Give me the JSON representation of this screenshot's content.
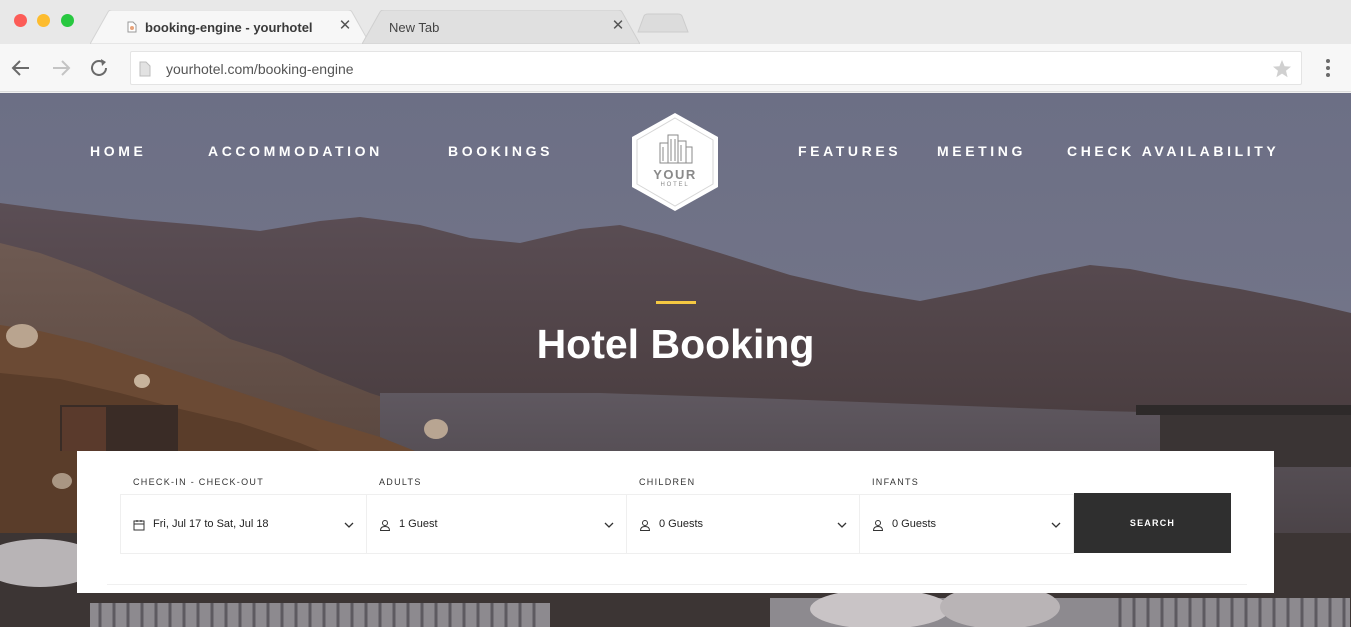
{
  "browser": {
    "tabs": [
      {
        "title": "booking-engine - yourhotel",
        "active": true
      },
      {
        "title": "New Tab",
        "active": false
      }
    ],
    "close_glyph": "✕",
    "url": "yourhotel.com/booking-engine",
    "icons": [
      "arrow-left-icon",
      "arrow-right-icon",
      "reload-icon",
      "page-icon",
      "star-icon",
      "kebab-menu-icon",
      "close-icon"
    ]
  },
  "nav": {
    "left": [
      "HOME",
      "ACCOMMODATION",
      "BOOKINGS"
    ],
    "right": [
      "FEATURES",
      "MEETING",
      "CHECK AVAILABILITY"
    ]
  },
  "logo": {
    "line1": "YOUR",
    "line2": "HOTEL"
  },
  "hero": {
    "title": "Hotel Booking",
    "accent_color": "#f5c842"
  },
  "booking": {
    "dates": {
      "label": "CHECK-IN - CHECK-OUT",
      "value": "Fri, Jul 17 to Sat, Jul 18"
    },
    "adults": {
      "label": "ADULTS",
      "value": "1 Guest"
    },
    "children": {
      "label": "CHILDREN",
      "value": "0 Guests"
    },
    "infants": {
      "label": "INFANTS",
      "value": "0 Guests"
    },
    "search_label": "SEARCH",
    "button_color": "#2f2f2f"
  }
}
